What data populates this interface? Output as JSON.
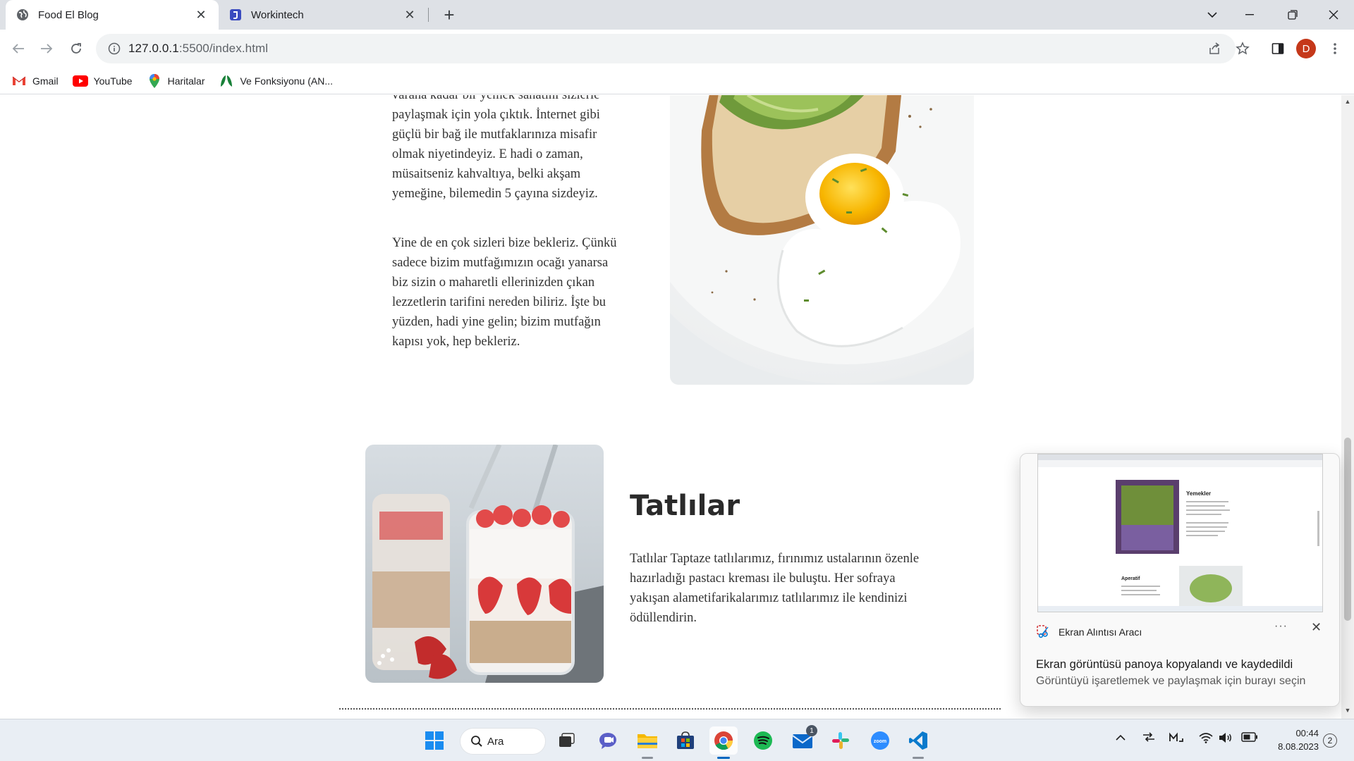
{
  "browser": {
    "tabs": [
      {
        "title": "Food El Blog",
        "active": true
      },
      {
        "title": "Workintech",
        "active": false
      }
    ],
    "url_host": "127.0.0.1",
    "url_path": ":5500/index.html",
    "profile_initial": "D",
    "bookmarks": [
      "Gmail",
      "YouTube",
      "Haritalar",
      "Ve Fonksiyonu (AN..."
    ]
  },
  "page": {
    "intro_partial": "varana kadar bir yemek sanatını sizlerle",
    "intro_lines": [
      "paylaşmak için yola çıktık. İnternet gibi",
      "güçlü bir bağ ile mutfaklarınıza misafir",
      "olmak niyetindeyiz. E hadi o zaman,",
      "müsaitseniz kahvaltıya, belki akşam",
      "yemeğine, bilemedin 5 çayına sizdeyiz."
    ],
    "invite_lines": [
      "Yine de en çok sizleri bize bekleriz. Çünkü",
      "sadece bizim mutfağımızın ocağı yanarsa",
      "biz sizin o maharetli ellerinizden çıkan",
      "lezzetlerin tarifini nereden biliriz. İşte bu",
      "yüzden, hadi yine gelin; bizim mutfağın",
      "kapısı yok, hep bekleriz."
    ],
    "dessert_title": "Tatlılar",
    "dessert_lines": [
      "Tatlılar Taptaze tatlılarımız, fırınımız ustalarının özenle",
      "hazırladığı pastacı kreması ile buluştu. Her sofraya",
      "yakışan alametifarikalarımız tatlılarımız ile kendinizi",
      "ödüllendirin."
    ]
  },
  "toast": {
    "app_name": "Ekran Alıntısı Aracı",
    "more": "···",
    "title": "Ekran görüntüsü panoya kopyalandı ve kaydedildi",
    "subtitle": "Görüntüyü işaretlemek ve paylaşmak için burayı seçin",
    "preview_heading_1": "Yemekler",
    "preview_heading_2": "Aperatif"
  },
  "taskbar": {
    "search_label": "Ara",
    "mail_badge": "1",
    "time": "00:44",
    "date": "8.08.2023",
    "notification_count": "2"
  },
  "colors": {
    "chrome_tab_bg": "#dee1e6",
    "profile_avatar": "#c5381a",
    "taskbar_bg": "#e9eef4",
    "text": "#333333"
  }
}
